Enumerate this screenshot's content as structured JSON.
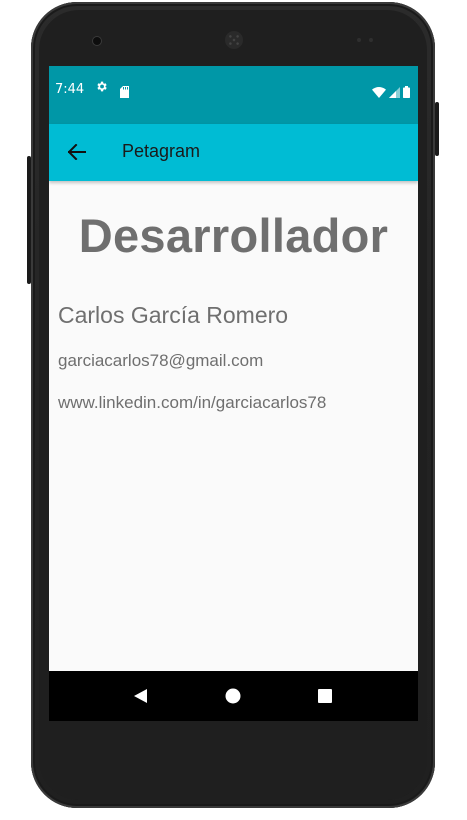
{
  "status_bar": {
    "time": "7:44",
    "background": "#0097a7",
    "icons": [
      "gear-icon",
      "sd-card-icon",
      "wifi-icon",
      "signal-icon",
      "battery-icon"
    ]
  },
  "app_bar": {
    "title": "Petagram",
    "background": "#00bcd4",
    "back_icon": "arrow-back-icon"
  },
  "content": {
    "heading": "Desarrollador",
    "name": "Carlos García Romero",
    "email": "garciacarlos78@gmail.com",
    "linkedin": "www.linkedin.com/in/garciacarlos78",
    "text_color": "#6f6f6f"
  },
  "nav_bar": {
    "buttons": [
      "back-triangle-icon",
      "home-circle-icon",
      "recents-square-icon"
    ]
  }
}
